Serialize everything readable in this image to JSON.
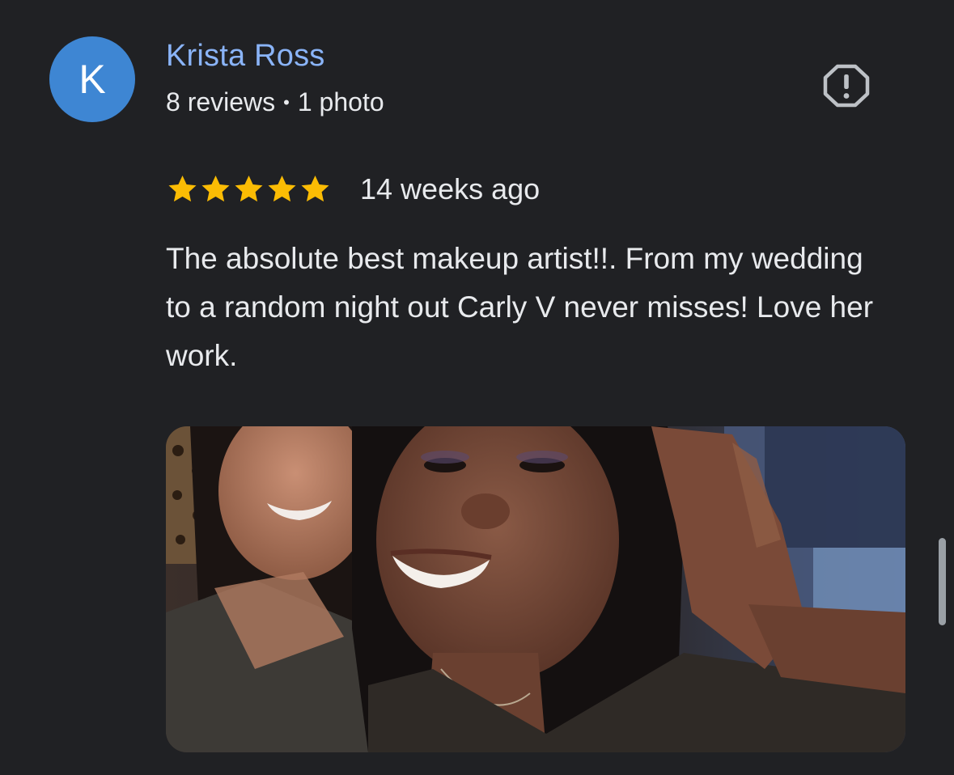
{
  "review": {
    "avatar_letter": "K",
    "avatar_color": "#3e86d3",
    "reviewer_name": "Krista Ross",
    "reviews_count": "8 reviews",
    "meta_separator": "•",
    "photos_count": "1 photo",
    "rating": 5,
    "rating_max": 5,
    "star_color": "#fbbc04",
    "date": "14 weeks ago",
    "text": "The absolute best makeup artist!!. From my wedding to a random night out Carly V never misses! Love her work.",
    "report_icon": "report-icon",
    "photo_icon": "review-photo"
  },
  "theme": {
    "background": "#202124",
    "name_color": "#8ab4f8",
    "text_color": "#e8eaed"
  }
}
